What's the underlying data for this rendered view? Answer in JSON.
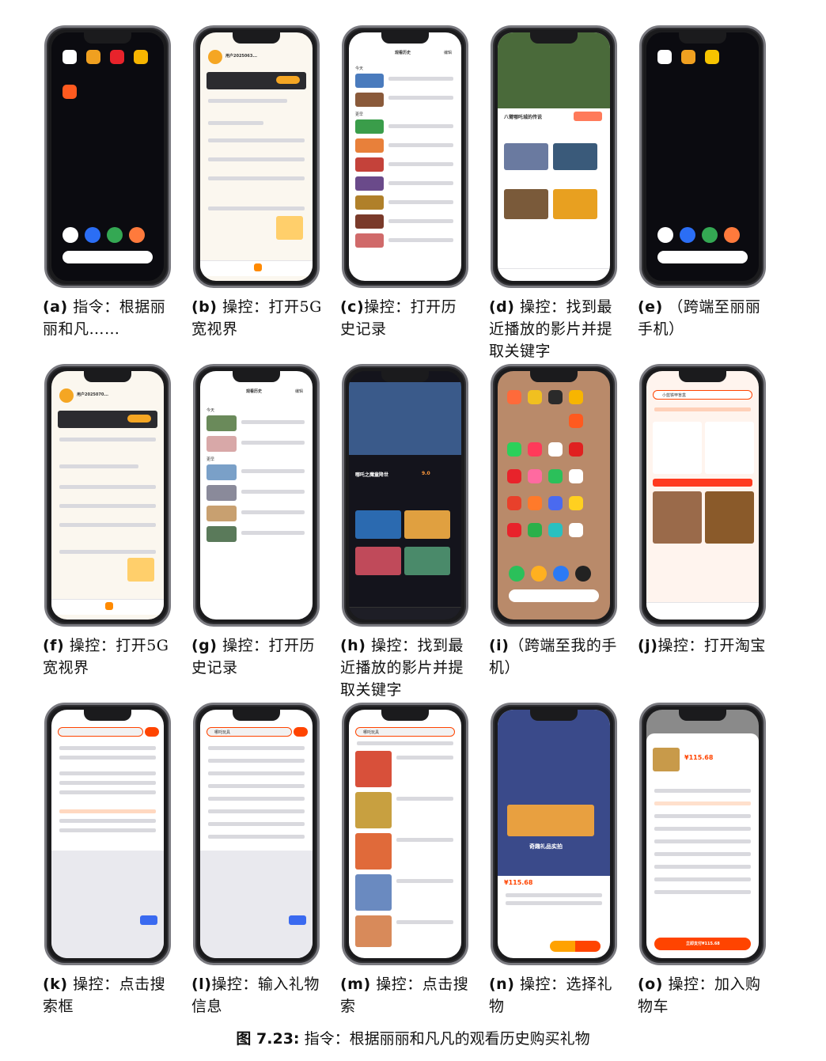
{
  "panels": [
    {
      "label": "(a)",
      "caption": "指令：根据丽丽和凡……",
      "theme": "home-dark"
    },
    {
      "label": "(b)",
      "caption": "操控：打开5G宽视界",
      "theme": "profile"
    },
    {
      "label": "(c)",
      "caption": "操控：打开历史记录",
      "theme": "history"
    },
    {
      "label": "(d)",
      "caption": "操控：找到最近播放的影片并提取关键字",
      "theme": "video"
    },
    {
      "label": "(e)",
      "caption": "（跨端至丽丽手机）",
      "theme": "home-dark"
    },
    {
      "label": "(f)",
      "caption": "操控：打开5G宽视界",
      "theme": "profile"
    },
    {
      "label": "(g)",
      "caption": "操控：打开历史记录",
      "theme": "history"
    },
    {
      "label": "(h)",
      "caption": "操控：找到最近播放的影片并提取关键字",
      "theme": "video-dark"
    },
    {
      "label": "(i)",
      "caption": "（跨端至我的手机）",
      "theme": "home-apps"
    },
    {
      "label": "(j)",
      "caption": "操控：打开淘宝",
      "theme": "shop"
    },
    {
      "label": "(k)",
      "caption": "操控：点击搜索框",
      "theme": "keyboard"
    },
    {
      "label": "(l)",
      "caption": "操控：输入礼物信息",
      "theme": "keyboard"
    },
    {
      "label": "(m)",
      "caption": "操控：点击搜索",
      "theme": "results"
    },
    {
      "label": "(n)",
      "caption": "操控：选择礼物",
      "theme": "product"
    },
    {
      "label": "(o)",
      "caption": "操控：加入购物车",
      "theme": "cart"
    }
  ],
  "figure": {
    "number": "图 7.23:",
    "title": "指令：根据丽丽和凡凡的观看历史购买礼物"
  },
  "screen_text": {
    "user_a": "用户2025063...",
    "user_f": "用户2025070...",
    "history_title": "观看历史",
    "edit": "编辑",
    "today": "今天",
    "earlier": "更早",
    "movie_d": "八臂哪吒城的传说",
    "movie_h": "哪吒之魔童降世",
    "rating_h": "9.0",
    "taobao_search": "小蓝铁甲盲盒",
    "query": "哪吒玩具",
    "search_btn": "搜索",
    "price_n": "¥115.68",
    "price_o": "¥115.68",
    "buy_btn": "立即支付¥115.68",
    "gift_banner": "奇趣礼品实拍"
  },
  "colors": {
    "accent_orange": "#ff6a00",
    "taobao_red": "#ff4400",
    "profile_gold": "#f5a623",
    "dark_bg": "#0d0d12"
  }
}
